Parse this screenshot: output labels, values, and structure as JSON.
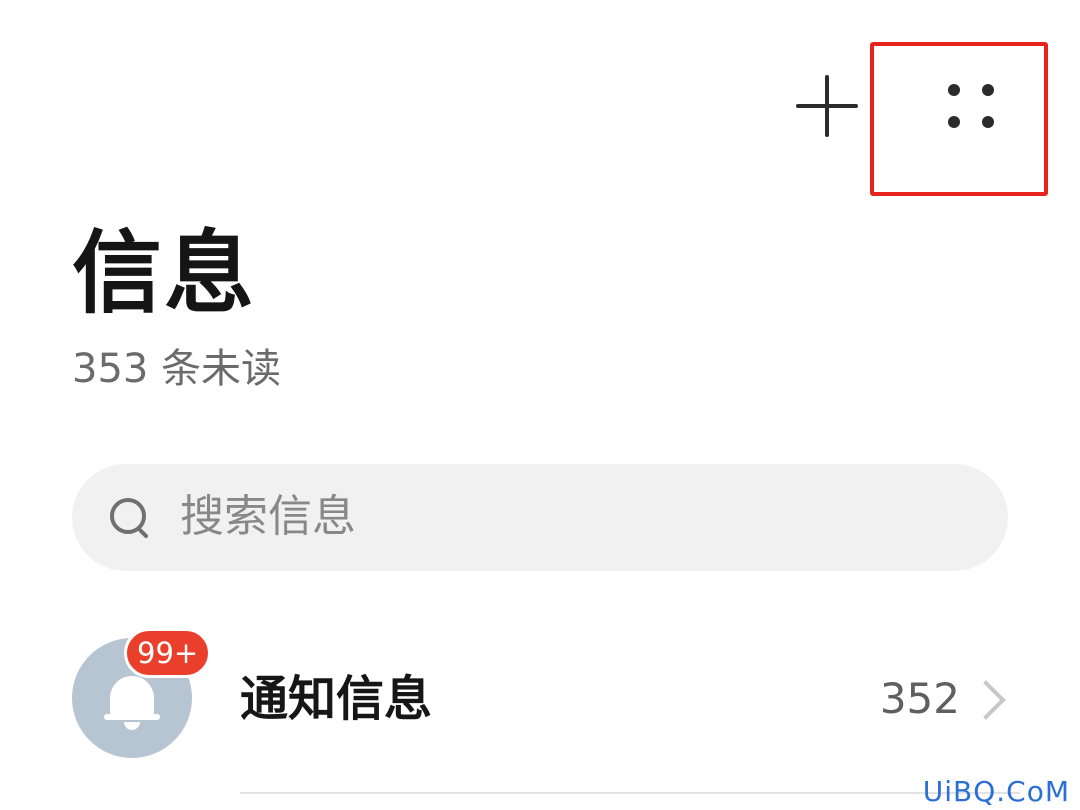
{
  "header": {
    "add_icon": "plus-icon",
    "more_icon": "four-dot-grid-icon",
    "highlight_color": "#e8231d"
  },
  "title": {
    "text": "信息",
    "unread": "353 条未读"
  },
  "search": {
    "icon": "search-icon",
    "placeholder": "搜索信息"
  },
  "list": {
    "items": [
      {
        "title": "通知信息",
        "badge": "99+",
        "count": "352",
        "avatar_icon": "bell-icon",
        "avatar_color": "#b7c4d2",
        "badge_color": "#ea3f2a"
      }
    ]
  },
  "watermark": "UiBQ.CoM"
}
